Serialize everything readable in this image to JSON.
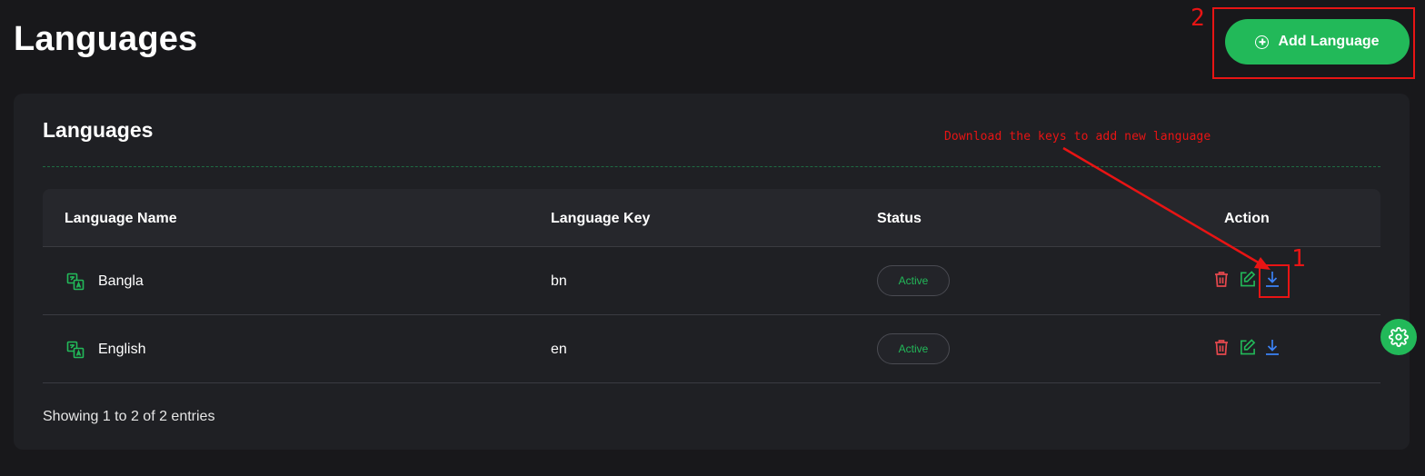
{
  "page": {
    "title": "Languages",
    "add_button_label": "Add Language"
  },
  "card": {
    "title": "Languages",
    "columns": [
      "Language Name",
      "Language Key",
      "Status",
      "Action"
    ],
    "rows": [
      {
        "name": "Bangla",
        "key": "bn",
        "status": "Active"
      },
      {
        "name": "English",
        "key": "en",
        "status": "Active"
      }
    ],
    "footer": "Showing 1 to 2 of 2 entries"
  },
  "annotations": {
    "label_1": "1",
    "label_2": "2",
    "note": "Download the keys to add new language"
  },
  "icons": {
    "add": "plus-circle-icon",
    "language": "translate-icon",
    "delete": "trash-icon",
    "edit": "edit-icon",
    "download": "download-icon",
    "settings": "gear-icon"
  },
  "colors": {
    "background": "#18181b",
    "card": "#1f2024",
    "accent_green": "#22b959",
    "delete_red": "#e5484d",
    "download_blue": "#3b82f6",
    "annotation_red": "#e81414"
  }
}
